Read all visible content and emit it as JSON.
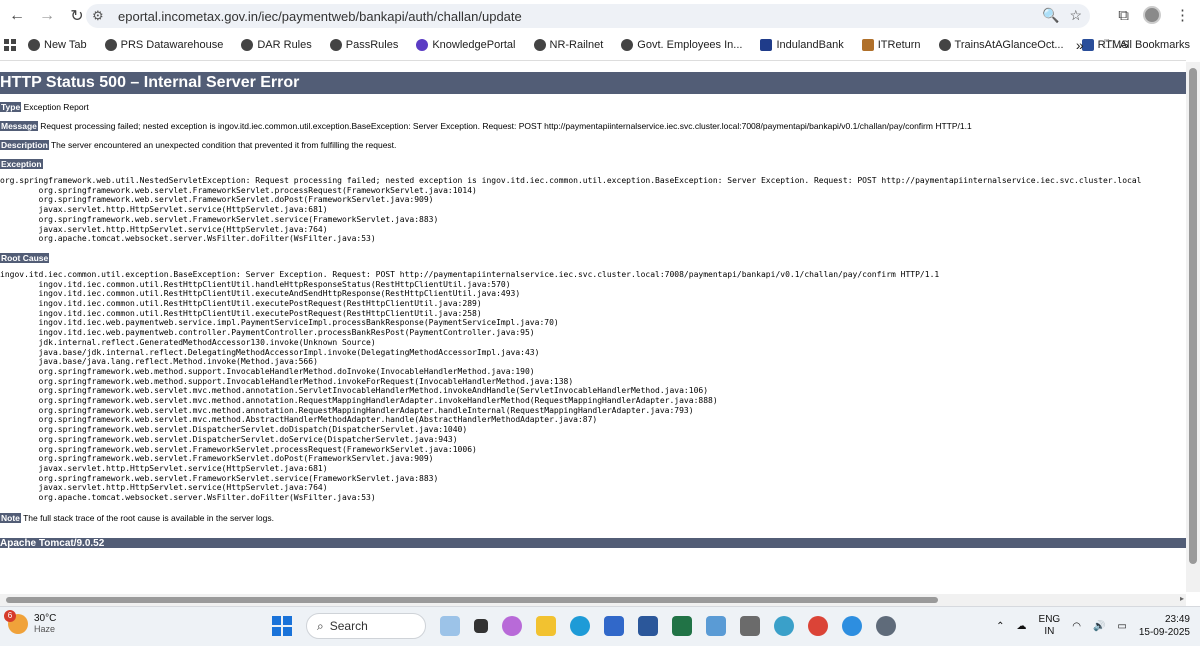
{
  "browser": {
    "url": "eportal.incometax.gov.in/iec/paymentweb/bankapi/auth/challan/update",
    "bookmarks": [
      "New Tab",
      "PRS Datawarehouse",
      "DAR Rules",
      "PassRules",
      "KnowledgePortal",
      "NR-Railnet",
      "Govt. Employees In...",
      "IndulandBank",
      "ITReturn",
      "TrainsAtAGlanceOct...",
      "RTMS"
    ],
    "more": "»",
    "all_bookmarks": "All Bookmarks"
  },
  "error": {
    "title": "HTTP Status 500 – Internal Server Error",
    "type_label": "Type",
    "type_value": "Exception Report",
    "message_label": "Message",
    "message_value": "Request processing failed; nested exception is ingov.itd.iec.common.util.exception.BaseException: Server Exception. Request: POST http://paymentapiinternalservice.iec.svc.cluster.local:7008/paymentapi/bankapi/v0.1/challan/pay/confirm HTTP/1.1",
    "description_label": "Description",
    "description_value": "The server encountered an unexpected condition that prevented it from fulfilling the request.",
    "exception_label": "Exception",
    "exception_trace": "org.springframework.web.util.NestedServletException: Request processing failed; nested exception is ingov.itd.iec.common.util.exception.BaseException: Server Exception. Request: POST http://paymentapiinternalservice.iec.svc.cluster.local\n\torg.springframework.web.servlet.FrameworkServlet.processRequest(FrameworkServlet.java:1014)\n\torg.springframework.web.servlet.FrameworkServlet.doPost(FrameworkServlet.java:909)\n\tjavax.servlet.http.HttpServlet.service(HttpServlet.java:681)\n\torg.springframework.web.servlet.FrameworkServlet.service(FrameworkServlet.java:883)\n\tjavax.servlet.http.HttpServlet.service(HttpServlet.java:764)\n\torg.apache.tomcat.websocket.server.WsFilter.doFilter(WsFilter.java:53)",
    "root_cause_label": "Root Cause",
    "root_cause_trace": "ingov.itd.iec.common.util.exception.BaseException: Server Exception. Request: POST http://paymentapiinternalservice.iec.svc.cluster.local:7008/paymentapi/bankapi/v0.1/challan/pay/confirm HTTP/1.1\n\tingov.itd.iec.common.util.RestHttpClientUtil.handleHttpResponseStatus(RestHttpClientUtil.java:570)\n\tingov.itd.iec.common.util.RestHttpClientUtil.executeAndSendHttpResponse(RestHttpClientUtil.java:493)\n\tingov.itd.iec.common.util.RestHttpClientUtil.executePostRequest(RestHttpClientUtil.java:289)\n\tingov.itd.iec.common.util.RestHttpClientUtil.executePostRequest(RestHttpClientUtil.java:258)\n\tingov.itd.iec.web.paymentweb.service.impl.PaymentServiceImpl.processBankResponse(PaymentServiceImpl.java:70)\n\tingov.itd.iec.web.paymentweb.controller.PaymentController.processBankResPost(PaymentController.java:95)\n\tjdk.internal.reflect.GeneratedMethodAccessor130.invoke(Unknown Source)\n\tjava.base/jdk.internal.reflect.DelegatingMethodAccessorImpl.invoke(DelegatingMethodAccessorImpl.java:43)\n\tjava.base/java.lang.reflect.Method.invoke(Method.java:566)\n\torg.springframework.web.method.support.InvocableHandlerMethod.doInvoke(InvocableHandlerMethod.java:190)\n\torg.springframework.web.method.support.InvocableHandlerMethod.invokeForRequest(InvocableHandlerMethod.java:138)\n\torg.springframework.web.servlet.mvc.method.annotation.ServletInvocableHandlerMethod.invokeAndHandle(ServletInvocableHandlerMethod.java:106)\n\torg.springframework.web.servlet.mvc.method.annotation.RequestMappingHandlerAdapter.invokeHandlerMethod(RequestMappingHandlerAdapter.java:888)\n\torg.springframework.web.servlet.mvc.method.annotation.RequestMappingHandlerAdapter.handleInternal(RequestMappingHandlerAdapter.java:793)\n\torg.springframework.web.servlet.mvc.method.AbstractHandlerMethodAdapter.handle(AbstractHandlerMethodAdapter.java:87)\n\torg.springframework.web.servlet.DispatcherServlet.doDispatch(DispatcherServlet.java:1040)\n\torg.springframework.web.servlet.DispatcherServlet.doService(DispatcherServlet.java:943)\n\torg.springframework.web.servlet.FrameworkServlet.processRequest(FrameworkServlet.java:1006)\n\torg.springframework.web.servlet.FrameworkServlet.doPost(FrameworkServlet.java:909)\n\tjavax.servlet.http.HttpServlet.service(HttpServlet.java:681)\n\torg.springframework.web.servlet.FrameworkServlet.service(FrameworkServlet.java:883)\n\tjavax.servlet.http.HttpServlet.service(HttpServlet.java:764)\n\torg.apache.tomcat.websocket.server.WsFilter.doFilter(WsFilter.java:53)",
    "note_label": "Note",
    "note_value": "The full stack trace of the root cause is available in the server logs.",
    "footer": "Apache Tomcat/9.0.52"
  },
  "taskbar": {
    "badge": "6",
    "temperature": "30°C",
    "weather": "Haze",
    "search_placeholder": "Search",
    "lang_top": "ENG",
    "lang_bottom": "IN",
    "time": "23:49",
    "date": "15-09-2025"
  },
  "colors": {
    "tomcat_header": "#525d76",
    "accent": "#1a73d9"
  }
}
